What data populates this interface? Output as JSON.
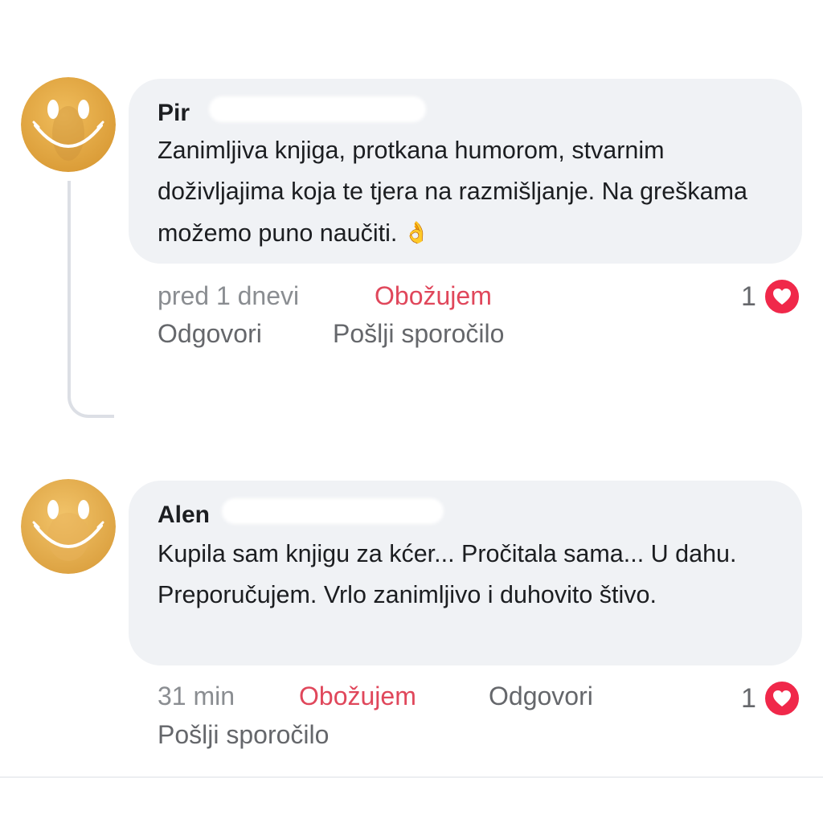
{
  "comments": [
    {
      "author": "Pir",
      "text": "Zanimljiva knjiga, protkana humorom, stvarnim doživljajima koja te tjera na razmišljanje. Na greškama možemo puno naučiti.",
      "emoji_icon": "ok-hand-icon",
      "time": "pred 1 dnevi",
      "love_label": "Obožujem",
      "reply_label": "Odgovori",
      "message_label": "Pošlji sporočilo",
      "reaction_count": "1",
      "reaction_icon": "heart-icon"
    },
    {
      "author": "Alen",
      "text": "Kupila sam knjigu za kćer... Pročitala sama... U dahu. Preporučujem. Vrlo zanimljivo i duhovito štivo.",
      "time": "31 min",
      "love_label": "Obožujem",
      "reply_label": "Odgovori",
      "message_label": "Pošlji sporočilo",
      "reaction_count": "1",
      "reaction_icon": "heart-icon"
    }
  ],
  "colors": {
    "bubble": "#f0f2f5",
    "love_text": "#e0475b",
    "heart": "#f0284a",
    "avatar": "#e3a94a",
    "muted_text": "#65676b"
  }
}
